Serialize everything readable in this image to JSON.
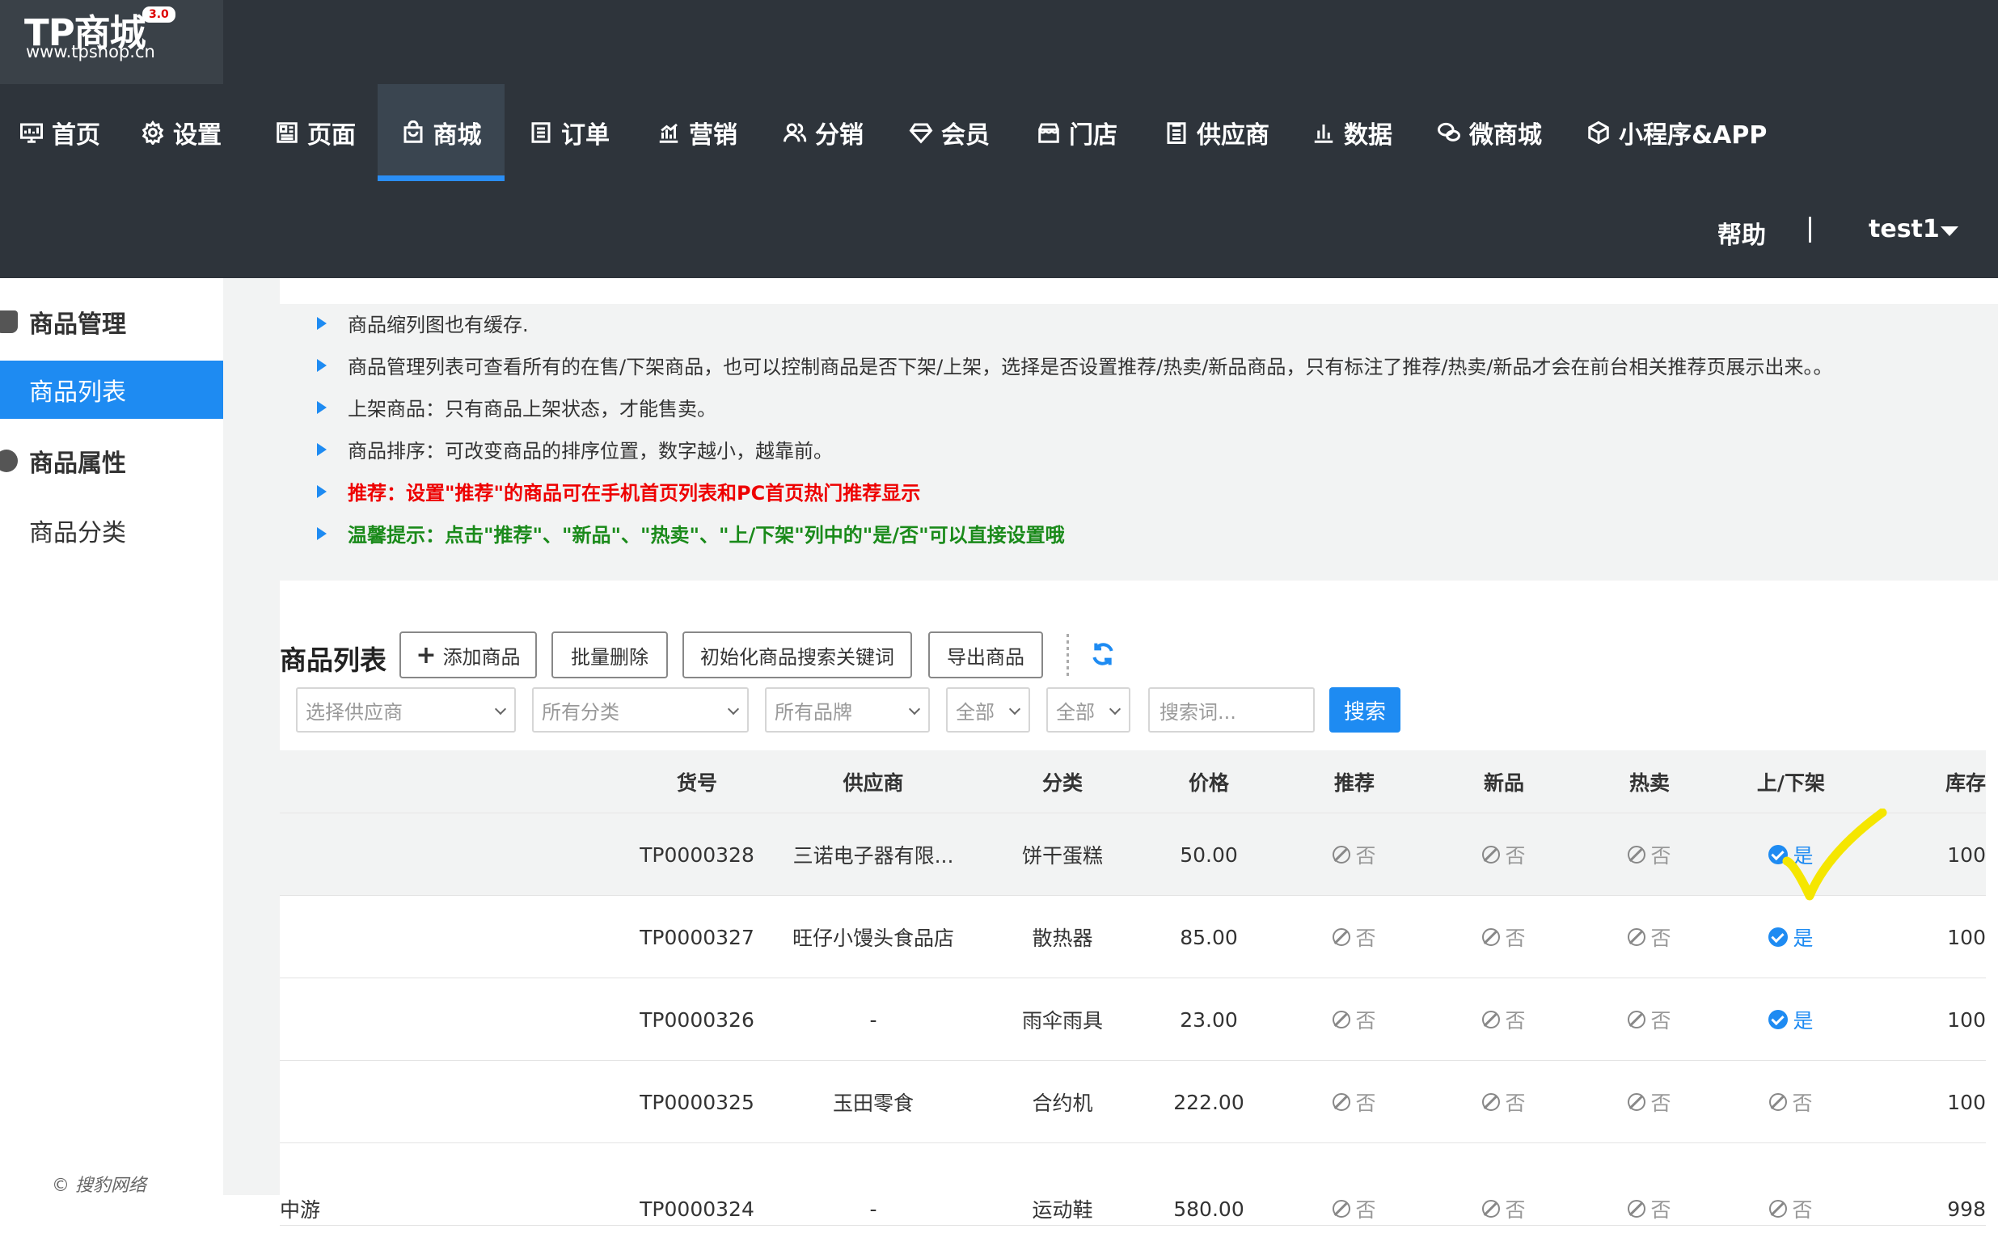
{
  "logo": {
    "title": "TP商城",
    "version": "3.0",
    "url": "www.tpshop.cn"
  },
  "nav": [
    {
      "label": "首页",
      "icon": "monitor-icon"
    },
    {
      "label": "设置",
      "icon": "gear-icon"
    },
    {
      "label": "页面",
      "icon": "layout-icon"
    },
    {
      "label": "商城",
      "icon": "bag-icon",
      "active": true
    },
    {
      "label": "订单",
      "icon": "list-icon"
    },
    {
      "label": "营销",
      "icon": "chart-icon"
    },
    {
      "label": "分销",
      "icon": "users-icon"
    },
    {
      "label": "会员",
      "icon": "diamond-icon"
    },
    {
      "label": "门店",
      "icon": "store-icon"
    },
    {
      "label": "供应商",
      "icon": "clipboard-icon"
    },
    {
      "label": "数据",
      "icon": "bars-icon"
    },
    {
      "label": "微商城",
      "icon": "wechat-icon"
    },
    {
      "label": "小程序&APP",
      "icon": "cube-icon"
    }
  ],
  "header": {
    "help": "帮助",
    "user": "test1"
  },
  "sidebar": {
    "group1": "商品管理",
    "item_list": "商品列表",
    "group2": "商品属性",
    "item_category": "商品分类",
    "copyright": "搜豹网络"
  },
  "tips": [
    "商品缩列图也有缓存.",
    "商品管理列表可查看所有的在售/下架商品，也可以控制商品是否下架/上架，选择是否设置推荐/热卖/新品商品，只有标注了推荐/热卖/新品才会在前台相关推荐页展示出来。。",
    "上架商品：只有商品上架状态，才能售卖。",
    "商品排序：可改变商品的排序位置，数字越小，越靠前。",
    "推荐：设置\"推荐\"的商品可在手机首页列表和PC首页热门推荐显示",
    "温馨提示：点击\"推荐\"、\"新品\"、\"热卖\"、\"上/下架\"列中的\"是/否\"可以直接设置哦"
  ],
  "toolbar": {
    "title": "商品列表",
    "add": "添加商品",
    "batch_delete": "批量删除",
    "init_keywords": "初始化商品搜索关键词",
    "export": "导出商品"
  },
  "filters": {
    "supplier": "选择供应商",
    "category": "所有分类",
    "brand": "所有品牌",
    "all1": "全部",
    "all2": "全部",
    "search_placeholder": "搜索词...",
    "search_btn": "搜索"
  },
  "table": {
    "headers": [
      "货号",
      "供应商",
      "分类",
      "价格",
      "推荐",
      "新品",
      "热卖",
      "上/下架",
      "库存"
    ],
    "yes": "是",
    "no": "否",
    "rows": [
      {
        "name": "",
        "sku": "TP0000328",
        "supplier": "三诺电子器有限...",
        "category": "饼干蛋糕",
        "price": "50.00",
        "recommend": false,
        "new": false,
        "hot": false,
        "on_sale": true,
        "stock": "100"
      },
      {
        "name": "",
        "sku": "TP0000327",
        "supplier": "旺仔小馒头食品店",
        "category": "散热器",
        "price": "85.00",
        "recommend": false,
        "new": false,
        "hot": false,
        "on_sale": true,
        "stock": "100"
      },
      {
        "name": "",
        "sku": "TP0000326",
        "supplier": "-",
        "category": "雨伞雨具",
        "price": "23.00",
        "recommend": false,
        "new": false,
        "hot": false,
        "on_sale": true,
        "stock": "100"
      },
      {
        "name": "",
        "sku": "TP0000325",
        "supplier": "玉田零食",
        "category": "合约机",
        "price": "222.00",
        "recommend": false,
        "new": false,
        "hot": false,
        "on_sale": false,
        "stock": "100"
      },
      {
        "name": "中游",
        "sku": "TP0000324",
        "supplier": "-",
        "category": "运动鞋",
        "price": "580.00",
        "recommend": false,
        "new": false,
        "hot": false,
        "on_sale": false,
        "stock": "998"
      }
    ]
  },
  "colors": {
    "header_bg": "#2e343b",
    "accent": "#1e8bf2",
    "tip_red": "#ee0000",
    "tip_green": "#1a8a1a",
    "annotation": "#f5e600"
  }
}
